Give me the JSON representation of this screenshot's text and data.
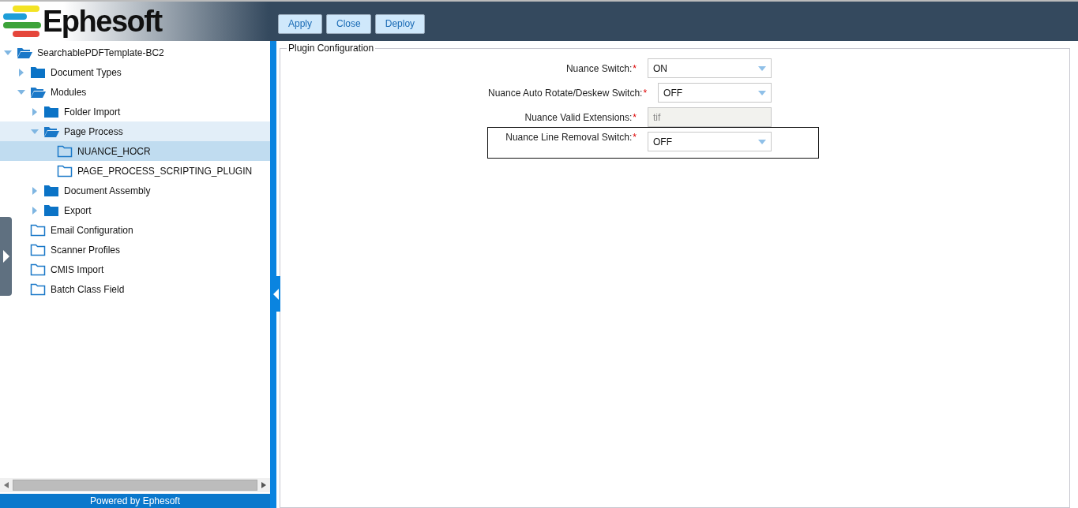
{
  "header": {
    "logo": "Ephesoft",
    "buttons": [
      "Apply",
      "Close",
      "Deploy"
    ]
  },
  "tree": [
    {
      "label": "SearchablePDFTemplate-BC2",
      "expanded": true,
      "selected": false,
      "hovered": false,
      "children": [
        {
          "label": "Document Types",
          "expanded": false,
          "selected": false,
          "hovered": false
        },
        {
          "label": "Modules",
          "expanded": true,
          "selected": false,
          "hovered": false,
          "children": [
            {
              "label": "Folder Import",
              "expanded": false,
              "selected": false,
              "hovered": false
            },
            {
              "label": "Page Process",
              "expanded": true,
              "selected": false,
              "hovered": true,
              "children": [
                {
                  "label": "NUANCE_HOCR",
                  "selected": true,
                  "hovered": false
                },
                {
                  "label": "PAGE_PROCESS_SCRIPTING_PLUGIN",
                  "selected": false,
                  "hovered": false
                }
              ]
            },
            {
              "label": "Document Assembly",
              "expanded": false,
              "selected": false,
              "hovered": false
            },
            {
              "label": "Export",
              "expanded": false,
              "selected": false,
              "hovered": false
            }
          ]
        },
        {
          "label": "Email Configuration",
          "selected": false,
          "hovered": false
        },
        {
          "label": "Scanner Profiles",
          "selected": false,
          "hovered": false
        },
        {
          "label": "CMIS Import",
          "selected": false,
          "hovered": false
        },
        {
          "label": "Batch Class Field",
          "selected": false,
          "hovered": false
        }
      ]
    }
  ],
  "footer": "Powered by Ephesoft",
  "plugin_configuration": {
    "title": "Plugin Configuration",
    "fields": [
      {
        "label": "Nuance Switch:",
        "required": "*",
        "kind": "select",
        "value": "ON",
        "disabled": false,
        "focused": false
      },
      {
        "label": "Nuance Auto Rotate/Deskew Switch:",
        "required": "*",
        "kind": "select",
        "value": "OFF",
        "disabled": false,
        "focused": false
      },
      {
        "label": "Nuance Valid Extensions:",
        "required": "*",
        "kind": "text",
        "value": "tif",
        "disabled": true,
        "focused": false
      },
      {
        "label": "Nuance Line Removal Switch:",
        "required": "*",
        "kind": "select",
        "value": "OFF",
        "disabled": false,
        "focused": true
      }
    ]
  }
}
